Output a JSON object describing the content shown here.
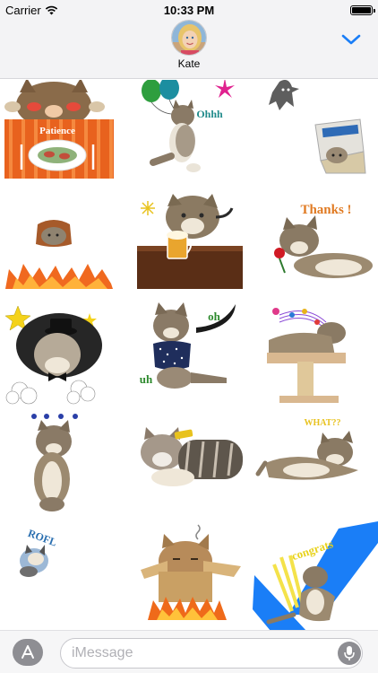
{
  "status_bar": {
    "carrier": "Carrier",
    "time": "10:33 PM",
    "battery_level": 1.0
  },
  "header": {
    "contact_name": "Kate",
    "expand_icon": "chevron-down-icon"
  },
  "stickers": [
    {
      "name": "cat-patience",
      "text": "Patience"
    },
    {
      "name": "cat-balloons",
      "text": "Ohhh"
    },
    {
      "name": "cat-ghost-box",
      "text": ""
    },
    {
      "name": "cat-fire",
      "text": ""
    },
    {
      "name": "cat-beer",
      "text": ""
    },
    {
      "name": "cat-thanks",
      "text": "Thanks !"
    },
    {
      "name": "cat-hat",
      "text": ""
    },
    {
      "name": "cat-uh-oh",
      "text_a": "oh",
      "text_b": "uh"
    },
    {
      "name": "cat-music",
      "text": ""
    },
    {
      "name": "cat-dots",
      "text": ""
    },
    {
      "name": "cat-lying",
      "text": ""
    },
    {
      "name": "cat-what",
      "text": "WHAT??"
    },
    {
      "name": "cat-rofl",
      "text": "ROFL"
    },
    {
      "name": "cat-box-fire",
      "text": ""
    },
    {
      "name": "cat-congrats",
      "text": "congrats"
    }
  ],
  "input_bar": {
    "placeholder": "iMessage",
    "app_button_icon": "app-store-icon",
    "mic_icon": "microphone-icon"
  },
  "colors": {
    "accent": "#1a7ef7",
    "header_bg": "#f3f3f5",
    "gray_button": "#8e8e93"
  }
}
